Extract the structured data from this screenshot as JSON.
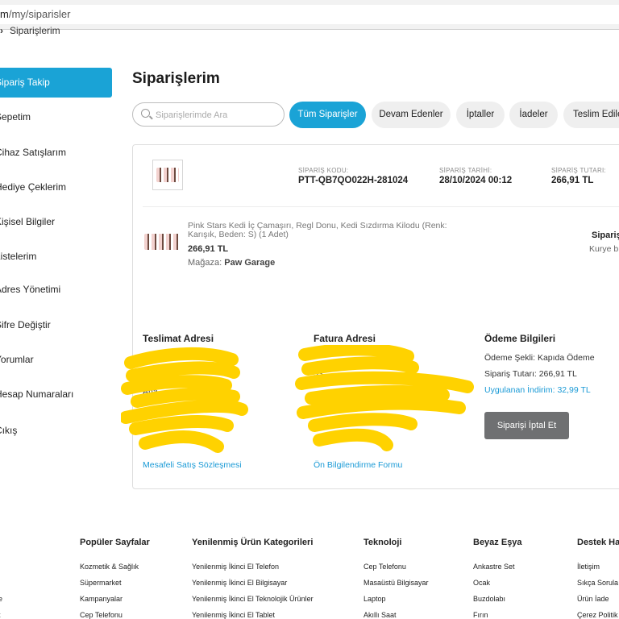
{
  "browser": {
    "url_host": "m",
    "url_path": "/my/siparisler"
  },
  "breadcrumb": {
    "label": "Siparişlerim"
  },
  "sidebar": {
    "items": [
      {
        "label": "Sipariş Takip"
      },
      {
        "label": "Sepetim"
      },
      {
        "label": "Cihaz Satışlarım"
      },
      {
        "label": "Hediye Çeklerim"
      },
      {
        "label": "Kişisel Bilgiler"
      },
      {
        "label": "Listelerim"
      },
      {
        "label": "Adres Yönetimi"
      },
      {
        "label": "Şifre Değiştir"
      },
      {
        "label": "Yorumlar"
      },
      {
        "label": "Hesap Numaraları"
      },
      {
        "label": "Çıkış"
      }
    ]
  },
  "page": {
    "title": "Siparişlerim"
  },
  "search": {
    "placeholder": "Siparişlerimde Ara"
  },
  "filters": [
    {
      "label": "Tüm Siparişler"
    },
    {
      "label": "Devam Edenler"
    },
    {
      "label": "İptaller"
    },
    {
      "label": "İadeler"
    },
    {
      "label": "Teslim Edilenler"
    }
  ],
  "order": {
    "code_label": "SİPARİŞ KODU:",
    "code": "PTT-QB7QO022H-281024",
    "date_label": "SİPARİŞ TARİHİ:",
    "date": "28/10/2024 00:12",
    "total_label": "SİPARİŞ TUTARI:",
    "total": "266,91 TL",
    "product": {
      "name": "Pink Stars Kedi İç Çamaşırı, Regl Donu, Kedi Sızdırma Kilodu (Renk: Karışık, Beden: S) (1 Adet)",
      "price": "266,91 TL",
      "store_label": "Mağaza:",
      "store": "Paw Garage"
    },
    "status_title": "Sipariş",
    "status_sub": "Kurye b"
  },
  "delivery": {
    "title": "Teslimat Adresi",
    "visible_lines": [
      "5",
      "Ana",
      "i",
      "KEL",
      "ANT"
    ],
    "link": "Mesafeli Satış Sözleşmesi"
  },
  "invoice": {
    "title": "Fatura Adresi",
    "visible_lines": [
      "53",
      "ANT",
      "AN"
    ],
    "link": "Ön Bilgilendirme Formu"
  },
  "payment": {
    "title": "Ödeme Bilgileri",
    "method": "Ödeme Şekli: Kapıda Ödeme",
    "amount": "Sipariş Tutarı: 266,91 TL",
    "discount": "Uygulanan İndirim: 32,99 TL",
    "cancel_label": "Siparişi İptal Et"
  },
  "footer": {
    "columns": [
      {
        "title": "Popüler Sayfalar",
        "items": [
          "Kozmetik & Sağlık",
          "Süpermarket",
          "Kampanyalar",
          "Cep Telefonu"
        ]
      },
      {
        "title": "Yenilenmiş Ürün Kategorileri",
        "items": [
          "Yenilenmiş İkinci El Telefon",
          "Yenilenmiş İkinci El Bilgisayar",
          "Yenilenmiş İkinci El Teknolojik Ürünler",
          "Yenilenmiş İkinci El Tablet"
        ]
      },
      {
        "title": "Teknoloji",
        "items": [
          "Cep Telefonu",
          "Masaüstü Bilgisayar",
          "Laptop",
          "Akıllı Saat"
        ]
      },
      {
        "title": "Beyaz Eşya",
        "items": [
          "Ankastre Set",
          "Ocak",
          "Buzdolabı",
          "Fırın"
        ]
      },
      {
        "title": "Destek Ha",
        "items": [
          "İletişim",
          "Sıkça Sorula",
          "Ürün İade",
          "Çerez Politik"
        ]
      }
    ],
    "left_edge_marks": [
      "e",
      "t"
    ]
  },
  "colors": {
    "accent": "#1aa3d6",
    "cancel_button": "#6f7072",
    "scribble": "#ffd200"
  }
}
